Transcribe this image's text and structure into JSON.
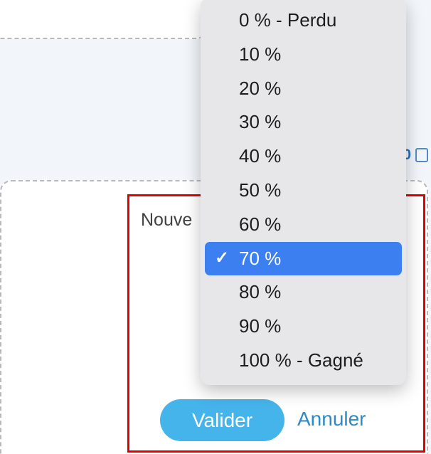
{
  "top_card": {},
  "right_fragment": {
    "count": "0"
  },
  "dialog": {
    "field_label": "Nouve",
    "validate_label": "Valider",
    "cancel_label": "Annuler"
  },
  "dropdown": {
    "items": [
      {
        "label": "0 % - Perdu",
        "selected": false
      },
      {
        "label": "10 %",
        "selected": false
      },
      {
        "label": "20 %",
        "selected": false
      },
      {
        "label": "30 %",
        "selected": false
      },
      {
        "label": "40 %",
        "selected": false
      },
      {
        "label": "50 %",
        "selected": false
      },
      {
        "label": "60 %",
        "selected": false
      },
      {
        "label": "70 %",
        "selected": true
      },
      {
        "label": "80 %",
        "selected": false
      },
      {
        "label": "90 %",
        "selected": false
      },
      {
        "label": "100 % - Gagné",
        "selected": false
      }
    ]
  }
}
